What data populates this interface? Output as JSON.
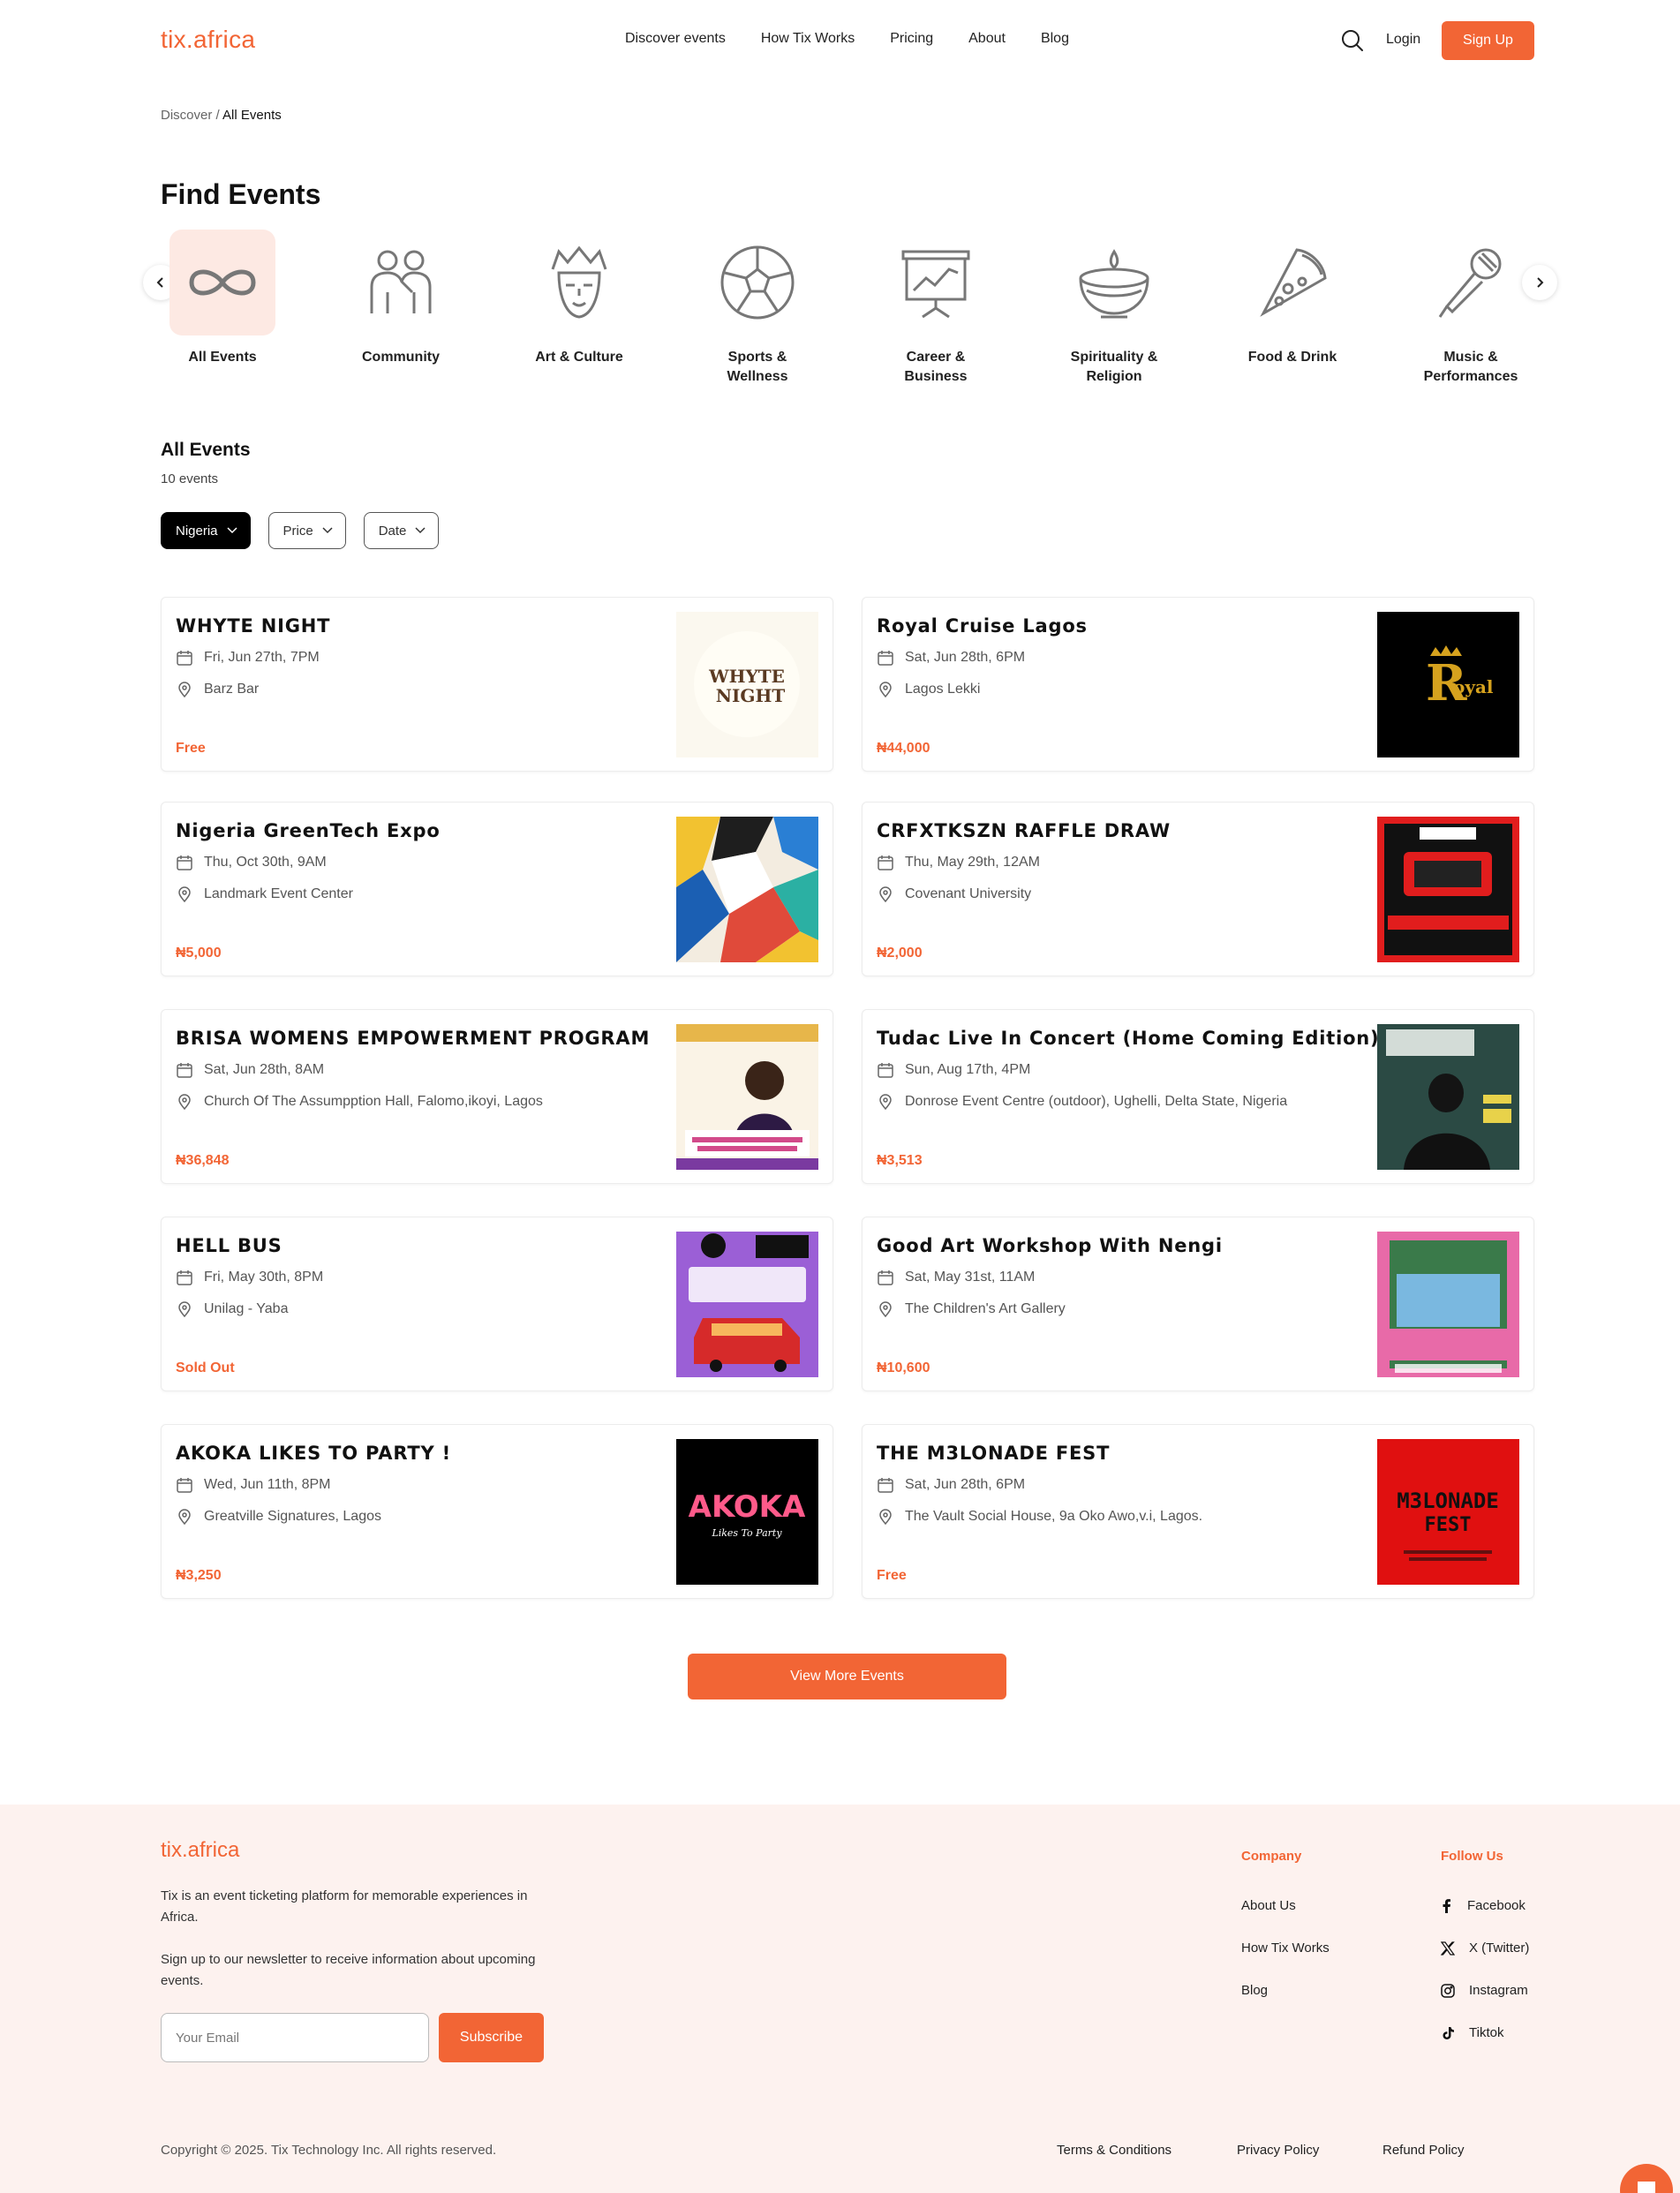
{
  "header": {
    "logo": "tix.africa",
    "nav": [
      "Discover events",
      "How Tix Works",
      "Pricing",
      "About",
      "Blog"
    ],
    "login": "Login",
    "signup": "Sign Up"
  },
  "breadcrumb": {
    "parent": "Discover",
    "separator": " / ",
    "current": "All Events"
  },
  "page_title": "Find Events",
  "categories": [
    {
      "label": "All Events",
      "icon": "infinity-icon",
      "active": true
    },
    {
      "label": "Community",
      "icon": "community-icon"
    },
    {
      "label": "Art & Culture",
      "icon": "mask-icon"
    },
    {
      "label": "Sports &\nWellness",
      "icon": "soccer-ball-icon"
    },
    {
      "label": "Career &\nBusiness",
      "icon": "presentation-board-icon"
    },
    {
      "label": "Spirituality &\nReligion",
      "icon": "candle-bowl-icon"
    },
    {
      "label": "Food & Drink",
      "icon": "pizza-slice-icon"
    },
    {
      "label": "Music &\nPerformances",
      "icon": "microphone-icon"
    }
  ],
  "section": {
    "title": "All Events",
    "count": "10 events"
  },
  "filters": [
    {
      "label": "Nigeria",
      "active": true
    },
    {
      "label": "Price"
    },
    {
      "label": "Date"
    }
  ],
  "events": [
    {
      "title": "WHYTE NIGHT",
      "date": "Fri, Jun 27th, 7PM",
      "venue": "Barz Bar",
      "price": "Free",
      "image": "whyte-night-poster"
    },
    {
      "title": "Royal Cruise Lagos",
      "date": "Sat, Jun 28th, 6PM",
      "venue": "Lagos Lekki",
      "price": "₦44,000",
      "image": "royal-cruise-poster"
    },
    {
      "title": "Nigeria GreenTech Expo",
      "date": "Thu, Oct 30th, 9AM",
      "venue": "Landmark Event Center",
      "price": "₦5,000",
      "image": "greentech-expo-poster"
    },
    {
      "title": "CRFXTKSZN RAFFLE DRAW",
      "date": "Thu, May 29th, 12AM",
      "venue": "Covenant University",
      "price": "₦2,000",
      "image": "raffle-draw-poster"
    },
    {
      "title": "BRISA WOMENS EMPOWERMENT PROGRAM",
      "date": "Sat, Jun 28th, 8AM",
      "venue": "Church Of The Assumpption Hall, Falomo,ikoyi, Lagos",
      "price": "₦36,848",
      "image": "brisa-poster"
    },
    {
      "title": "Tudac Live In Concert (Home Coming Edition)",
      "date": "Sun, Aug 17th, 4PM",
      "venue": "Donrose Event Centre (outdoor), Ughelli, Delta State, Nigeria",
      "price": "₦3,513",
      "image": "tudac-poster"
    },
    {
      "title": "HELL BUS",
      "date": "Fri, May 30th, 8PM",
      "venue": "Unilag - Yaba",
      "price": "Sold Out",
      "image": "hell-bus-poster"
    },
    {
      "title": "Good Art Workshop With Nengi",
      "date": "Sat, May 31st, 11AM",
      "venue": "The Children's Art Gallery",
      "price": "₦10,600",
      "image": "good-art-poster"
    },
    {
      "title": "AKOKA LIKES TO PARTY !",
      "date": "Wed, Jun 11th, 8PM",
      "venue": "Greatville Signatures, Lagos",
      "price": "₦3,250",
      "image": "akoka-poster"
    },
    {
      "title": "THE M3LONADE FEST",
      "date": "Sat, Jun 28th, 6PM",
      "venue": "The Vault Social House, 9a Oko Awo,v.i, Lagos.",
      "price": "Free",
      "image": "m3lonade-poster"
    }
  ],
  "view_more": "View More Events",
  "footer": {
    "logo": "tix.africa",
    "about": "Tix is an event ticketing platform for memorable experiences in Africa.",
    "newsletter": "Sign up to our newsletter to receive information about upcoming events.",
    "email_placeholder": "Your Email",
    "subscribe": "Subscribe",
    "company_title": "Company",
    "company_links": [
      "About Us",
      "How Tix Works",
      "Blog"
    ],
    "follow_title": "Follow Us",
    "social": [
      "Facebook",
      "X (Twitter)",
      "Instagram",
      "Tiktok"
    ],
    "copyright": "Copyright © 2025. Tix Technology Inc. All rights reserved.",
    "legal": [
      "Terms & Conditions",
      "Privacy Policy",
      "Refund Policy"
    ]
  },
  "colors": {
    "accent": "#f26535",
    "active_category_bg": "#fde9e3",
    "footer_bg": "#fdf2ef"
  }
}
